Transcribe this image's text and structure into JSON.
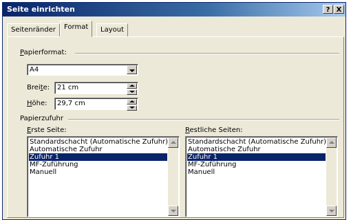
{
  "window": {
    "title": "Seite einrichten",
    "help_label": "?",
    "close_label": "X"
  },
  "tabs": [
    {
      "label": "Seitenränder",
      "active": false
    },
    {
      "label": "Format",
      "active": true
    },
    {
      "label": "Layout",
      "active": false
    }
  ],
  "paper_format": {
    "group_label_hotkey": "P",
    "group_label_rest": "apierformat:",
    "selected": "A4",
    "width_label_pre": "Brei",
    "width_label_hotkey": "t",
    "width_label_post": "e:",
    "width_value": "21 cm",
    "height_label_hotkey": "H",
    "height_label_rest": "öhe:",
    "height_value": "29,7 cm"
  },
  "paper_source": {
    "group_label": "Papierzufuhr",
    "first_page": {
      "label_hotkey": "E",
      "label_rest": "rste Seite:",
      "items": [
        "Standardschacht (Automatische Zufuhr)",
        "Automatische Zufuhr",
        "Zufuhr 1",
        "MF-Zuführung",
        "Manuell"
      ],
      "selected_index": 2
    },
    "other_pages": {
      "label_hotkey": "R",
      "label_rest": "estliche Seiten:",
      "items": [
        "Standardschacht (Automatische Zufuhr)",
        "Automatische Zufuhr",
        "Zufuhr 1",
        "MF-Zuführung",
        "Manuell"
      ],
      "selected_index": 2
    }
  }
}
